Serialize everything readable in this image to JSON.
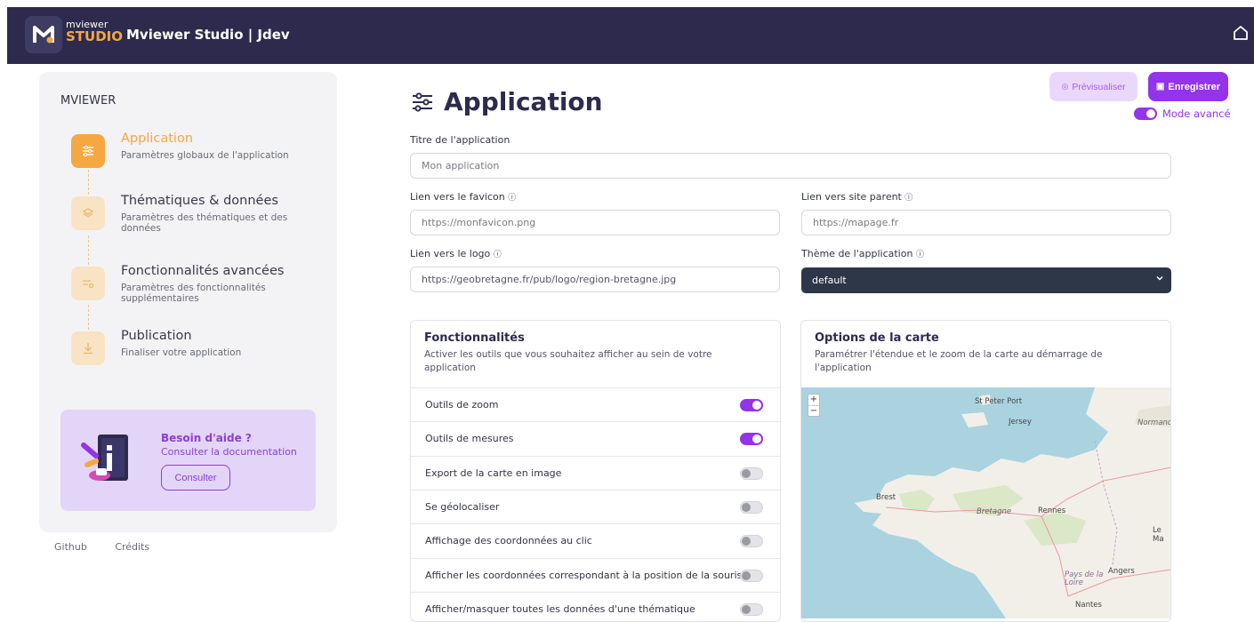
{
  "header": {
    "logo_top": "mviewer",
    "logo_bottom": "STUDIO",
    "title": "Mviewer Studio | Jdev"
  },
  "sidebar": {
    "title": "MVIEWER",
    "steps": [
      {
        "title": "Application",
        "desc": "Paramètres globaux de l'application"
      },
      {
        "title": "Thématiques & données",
        "desc": "Paramètres des thématiques et des données"
      },
      {
        "title": "Fonctionnalités avancées",
        "desc": "Paramètres des fonctionnalités supplémentaires"
      },
      {
        "title": "Publication",
        "desc": "Finaliser votre application"
      }
    ],
    "help": {
      "title": "Besoin d'aide ?",
      "subtitle": "Consulter la documentation",
      "button": "Consulter"
    },
    "footer": {
      "github": "Github",
      "credits": "Crédits"
    }
  },
  "main": {
    "title": "Application",
    "preview_button": "Prévisualiser",
    "save_button": "Enregistrer",
    "mode_label": "Mode avancé",
    "fields": {
      "app_title_label": "Titre de l'application",
      "app_title_placeholder": "Mon application",
      "favicon_label": "Lien vers le favicon",
      "favicon_placeholder": "https://monfavicon.png",
      "parent_label": "Lien vers site parent",
      "parent_placeholder": "https://mapage.fr",
      "logo_label": "Lien vers le logo",
      "logo_value": "https://geobretagne.fr/pub/logo/region-bretagne.jpg",
      "theme_label": "Thème de l'application",
      "theme_value": "default"
    },
    "features": {
      "title": "Fonctionnalités",
      "desc": "Activer les outils que vous souhaitez afficher au sein de votre application",
      "items": [
        {
          "label": "Outils de zoom",
          "on": true
        },
        {
          "label": "Outils de mesures",
          "on": true
        },
        {
          "label": "Export de la carte en image",
          "on": false
        },
        {
          "label": "Se géolocaliser",
          "on": false
        },
        {
          "label": "Affichage des coordonnées au clic",
          "on": false
        },
        {
          "label": "Afficher les coordonnées correspondant à la position de la souris",
          "on": false
        },
        {
          "label": "Afficher/masquer toutes les données d'une thématique",
          "on": false
        }
      ]
    },
    "map_options": {
      "title": "Options de la carte",
      "desc": "Paramétrer l'étendue et le zoom de la carte au démarrage de l'application",
      "zoom_in": "+",
      "zoom_out": "−",
      "places": {
        "st_peter_port": "St Peter Port",
        "jersey": "Jersey",
        "normandie": "Normandi",
        "brest": "Brest",
        "bretagne": "Bretagne",
        "rennes": "Rennes",
        "le_mans": "Le Ma",
        "pays_de_la_loire": "Pays de la Loire",
        "angers": "Angers",
        "nantes": "Nantes"
      }
    }
  },
  "colors": {
    "header_bg": "#2d2a4e",
    "accent_orange": "#f5a742",
    "accent_purple": "#9333ea"
  }
}
